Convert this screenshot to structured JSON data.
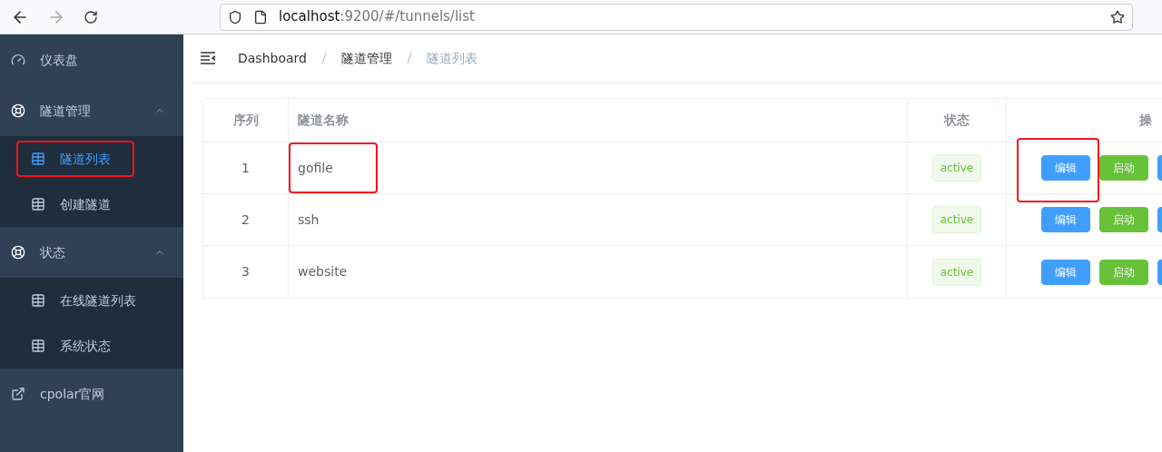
{
  "browser": {
    "url_host": "localhost",
    "url_rest": ":9200/#/tunnels/list"
  },
  "sidebar": {
    "items": [
      {
        "label": "仪表盘",
        "kind": "dashboard"
      },
      {
        "label": "隧道管理",
        "kind": "group",
        "expanded": true,
        "children": [
          {
            "label": "隧道列表",
            "selected": true,
            "highlighted": true
          },
          {
            "label": "创建隧道",
            "selected": false,
            "highlighted": false
          }
        ]
      },
      {
        "label": "状态",
        "kind": "group",
        "expanded": true,
        "children": [
          {
            "label": "在线隧道列表",
            "selected": false,
            "highlighted": false
          },
          {
            "label": "系统状态",
            "selected": false,
            "highlighted": false
          }
        ]
      },
      {
        "label": "cpolar官网",
        "kind": "external"
      }
    ]
  },
  "breadcrumb": [
    "Dashboard",
    "隧道管理",
    "隧道列表"
  ],
  "table": {
    "columns": [
      "序列",
      "隧道名称",
      "状态",
      "操"
    ],
    "rows": [
      {
        "index": "1",
        "name": "gofile",
        "status": "active",
        "name_highlighted": true,
        "actions": [
          {
            "label": "编辑",
            "kind": "primary",
            "highlighted": true
          },
          {
            "label": "启动",
            "kind": "success",
            "highlighted": false
          }
        ]
      },
      {
        "index": "2",
        "name": "ssh",
        "status": "active",
        "name_highlighted": false,
        "actions": [
          {
            "label": "编辑",
            "kind": "primary",
            "highlighted": false
          },
          {
            "label": "启动",
            "kind": "success",
            "highlighted": false
          }
        ]
      },
      {
        "index": "3",
        "name": "website",
        "status": "active",
        "name_highlighted": false,
        "actions": [
          {
            "label": "编辑",
            "kind": "primary",
            "highlighted": false
          },
          {
            "label": "启动",
            "kind": "success",
            "highlighted": false
          }
        ]
      }
    ]
  }
}
